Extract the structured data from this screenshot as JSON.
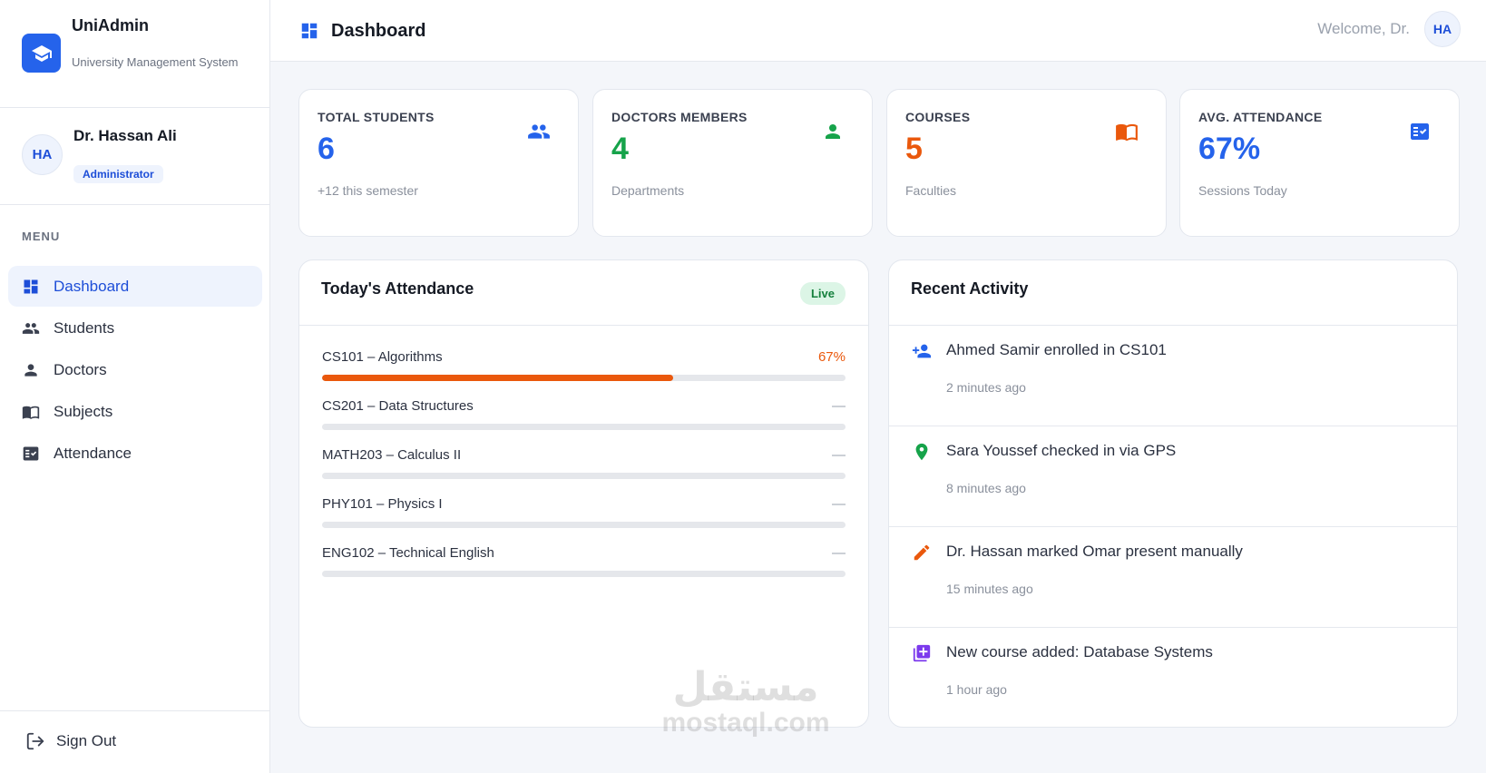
{
  "brand": {
    "name": "UniAdmin",
    "subtitle": "University Management System"
  },
  "profile": {
    "initials": "HA",
    "name": "Dr. Hassan Ali",
    "role": "Administrator"
  },
  "menu": {
    "label": "MENU",
    "items": [
      {
        "label": "Dashboard",
        "icon": "dashboard-icon",
        "active": true
      },
      {
        "label": "Students",
        "icon": "group-icon"
      },
      {
        "label": "Doctors",
        "icon": "person-icon"
      },
      {
        "label": "Subjects",
        "icon": "book-icon"
      },
      {
        "label": "Attendance",
        "icon": "fact-check-icon"
      }
    ],
    "signout": "Sign Out"
  },
  "topbar": {
    "title": "Dashboard",
    "welcome": "Welcome, Dr.",
    "initials": "HA"
  },
  "stats": [
    {
      "label": "TOTAL STUDENTS",
      "value": "6",
      "sub": "+12 this semester",
      "color": "#2563eb",
      "icon": "group-icon"
    },
    {
      "label": "DOCTORS MEMBERS",
      "value": "4",
      "sub": "Departments",
      "color": "#16a34a",
      "icon": "person-icon"
    },
    {
      "label": "COURSES",
      "value": "5",
      "sub": "Faculties",
      "color": "#ea580c",
      "icon": "book-icon"
    },
    {
      "label": "AVG. ATTENDANCE",
      "value": "67%",
      "sub": "Sessions Today",
      "color": "#2563eb",
      "icon": "fact-check-icon"
    }
  ],
  "attendance": {
    "title": "Today's Attendance",
    "badge": "Live",
    "rows": [
      {
        "course": "CS101 – Algorithms",
        "value": "67%",
        "progress": 0.67
      },
      {
        "course": "CS201 – Data Structures",
        "value": "—",
        "progress": 0
      },
      {
        "course": "MATH203 – Calculus II",
        "value": "—",
        "progress": 0
      },
      {
        "course": "PHY101 – Physics I",
        "value": "—",
        "progress": 0
      },
      {
        "course": "ENG102 – Technical English",
        "value": "—",
        "progress": 0
      }
    ]
  },
  "activity": {
    "title": "Recent Activity",
    "items": [
      {
        "text": "Ahmed Samir enrolled in CS101",
        "time": "2 minutes ago",
        "icon": "person-add-icon",
        "color": "#2563eb"
      },
      {
        "text": "Sara Youssef checked in via GPS",
        "time": "8 minutes ago",
        "icon": "location-pin-icon",
        "color": "#16a34a"
      },
      {
        "text": "Dr. Hassan marked Omar present manually",
        "time": "15 minutes ago",
        "icon": "pencil-icon",
        "color": "#ea580c"
      },
      {
        "text": "New course added: Database Systems",
        "time": "1 hour ago",
        "icon": "library-add-icon",
        "color": "#7c3aed"
      }
    ]
  },
  "watermark": {
    "arabic": "مستقل",
    "latin": "mostaql.com"
  }
}
